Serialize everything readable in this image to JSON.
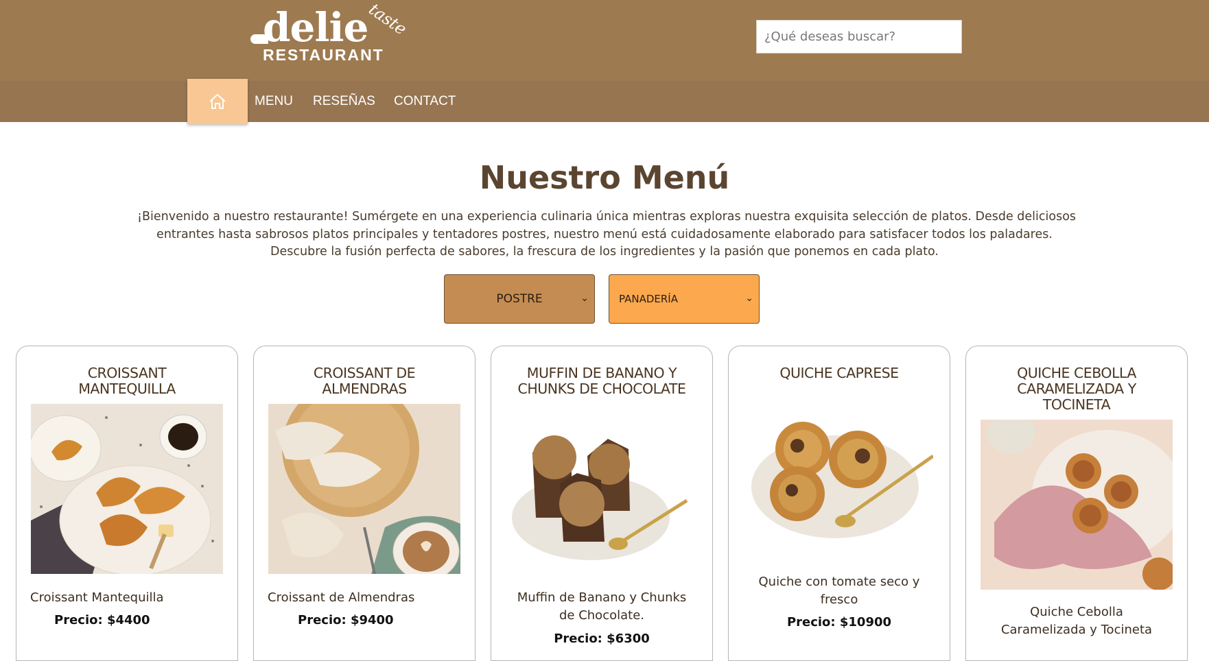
{
  "header": {
    "logo": {
      "main": "delie",
      "script": "taste",
      "sub": "RESTAURANT"
    },
    "search_placeholder": "¿Qué deseas buscar?"
  },
  "nav": {
    "home_icon": "home-icon",
    "items": [
      {
        "label": "MENU"
      },
      {
        "label": "RESEÑAS"
      },
      {
        "label": "CONTACT"
      }
    ]
  },
  "main": {
    "title": "Nuestro Menú",
    "intro_lines": [
      "¡Bienvenido a nuestro restaurante! Sumérgete en una experiencia culinaria única mientras exploras nuestra exquisita selección de platos. Desde deliciosos",
      "entrantes hasta sabrosos platos principales y tentadores postres, nuestro menú está cuidadosamente elaborado para satisfacer todos los paladares.",
      "Descubre la fusión perfecta de sabores, la frescura de los ingredientes y la pasión que ponemos en cada plato."
    ],
    "filters": [
      {
        "value": "POSTRE",
        "color": "#c48c53"
      },
      {
        "value": "PANADERÍA",
        "color": "#fba84e"
      }
    ]
  },
  "products": [
    {
      "title_lines": [
        "CROISSANT",
        "MANTEQUILLA"
      ],
      "desc": "Croissant Mantequilla",
      "price": "Precio: $4400",
      "image": "croissants-plate-photo"
    },
    {
      "title_lines": [
        "CROISSANT DE",
        "ALMENDRAS"
      ],
      "desc": "Croissant de Almendras",
      "price": "Precio: $9400",
      "image": "almond-croissants-photo"
    },
    {
      "title_lines": [
        "MUFFIN DE BANANO Y",
        "CHUNKS DE CHOCOLATE"
      ],
      "desc_lines": [
        "Muffin de Banano y Chunks",
        "de Chocolate."
      ],
      "price": "Precio: $6300",
      "image": "banana-muffins-photo"
    },
    {
      "title_lines": [
        "QUICHE CAPRESE"
      ],
      "desc_lines": [
        "Quiche con tomate seco y",
        "fresco"
      ],
      "price": "Precio: $10900",
      "image": "quiche-caprese-photo"
    },
    {
      "title_lines": [
        "QUICHE CEBOLLA",
        "CARAMELIZADA Y",
        "TOCINETA"
      ],
      "desc_lines": [
        "Quiche Cebolla",
        "Caramelizada y Tocineta"
      ],
      "image": "quiche-bacon-photo"
    }
  ],
  "colors": {
    "header": "#9d7a50",
    "nav": "#977551",
    "home_button": "#f8c793",
    "title": "#5b4531"
  }
}
